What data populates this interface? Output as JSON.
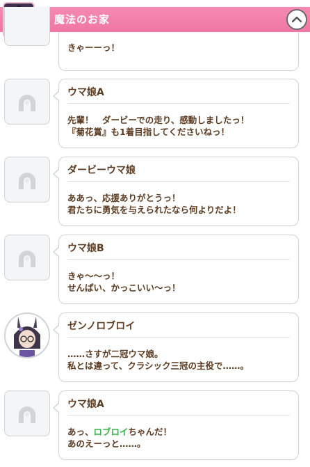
{
  "header": {
    "title": "魔法のお家"
  },
  "partial_message": {
    "text": "きゃーーっ！"
  },
  "messages": [
    {
      "speaker": "ウマ娘A",
      "line1": "先輩！　ダービーでの走り、感動しましたっ！",
      "line2": "『菊花賞』も1着目指してくださいねっ！"
    },
    {
      "speaker": "ダービーウマ娘",
      "line1": "ああっ、応援ありがとうっ！",
      "line2": "君たちに勇気を与えられたなら何よりだよ！"
    },
    {
      "speaker": "ウマ娘B",
      "line1": "きゃ～～っ！",
      "line2": "せんぱい、かっこいい～っ！"
    },
    {
      "speaker": "ゼンノロブロイ",
      "line1": "……さすが二冠ウマ娘。",
      "line2": "私とは違って、クラシック三冠の主役で……。"
    },
    {
      "speaker": "ウマ娘A",
      "line1_before": "あっ、",
      "line1_highlight": "ロブロイ",
      "line1_after": "ちゃんだ！",
      "line2": "あのえーっと……。"
    }
  ],
  "colors": {
    "header_pink": "#f27fa8",
    "text_brown": "#5b3b22",
    "highlight_green": "#36b24a",
    "border_gray": "#cfd3d6"
  }
}
